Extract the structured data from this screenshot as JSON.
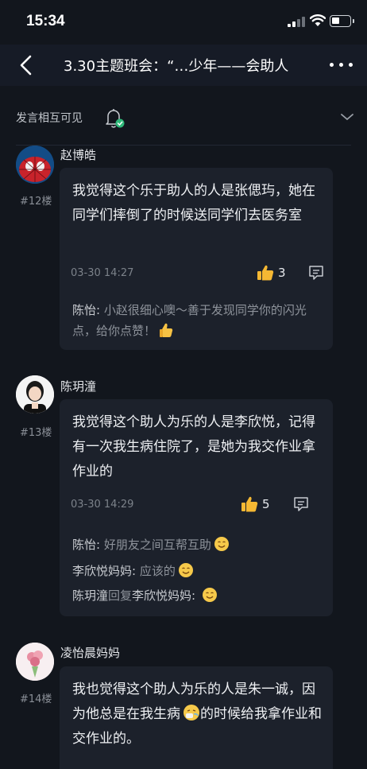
{
  "status_bar": {
    "time": "15:34"
  },
  "nav": {
    "title": "3.30主题班会：“…少年——会助人"
  },
  "visibility": {
    "label": "发言相互可见"
  },
  "posts": [
    {
      "author": "赵博皓",
      "floor": "#12楼",
      "content": "我觉得这个乐于助人的人是张偲玙，她在同学们摔倒了的时候送同学们去医务室",
      "timestamp": "03-30 14:27",
      "likes": "3",
      "replies": [
        {
          "name": "陈怡: ",
          "text": "小赵很细心噢～善于发现同学你的闪光点，给你点赞！",
          "emoji": "thumbs-up-emoji"
        }
      ]
    },
    {
      "author": "陈玥潼",
      "floor": "#13楼",
      "content": "我觉得这个助人为乐的人是李欣悦，记得有一次我生病住院了，是她为我交作业拿作业的",
      "timestamp": "03-30 14:29",
      "likes": "5",
      "replies": [
        {
          "name": "陈怡: ",
          "text": "好朋友之间互帮互助",
          "emoji": "smile-emoji"
        },
        {
          "name": "李欣悦妈妈: ",
          "text": "应该的",
          "emoji": "smile-emoji"
        },
        {
          "name": "陈玥潼",
          "reply_word": "回复",
          "to": "李欣悦妈妈: ",
          "emoji": "smile-emoji"
        }
      ]
    },
    {
      "author": "凌怡晨妈妈",
      "floor": "#14楼",
      "content_part1": "我也觉得这个助人为乐的人是朱一诚，因为他总是在我生病",
      "content_part2": "的时候给我拿作业和交作业的。",
      "content_emoji": "sick-emoji"
    }
  ],
  "colors": {
    "background": "#12161d",
    "card": "#1c212b",
    "reply_name": "#c9ccd1",
    "reply_text": "#8e939b"
  }
}
